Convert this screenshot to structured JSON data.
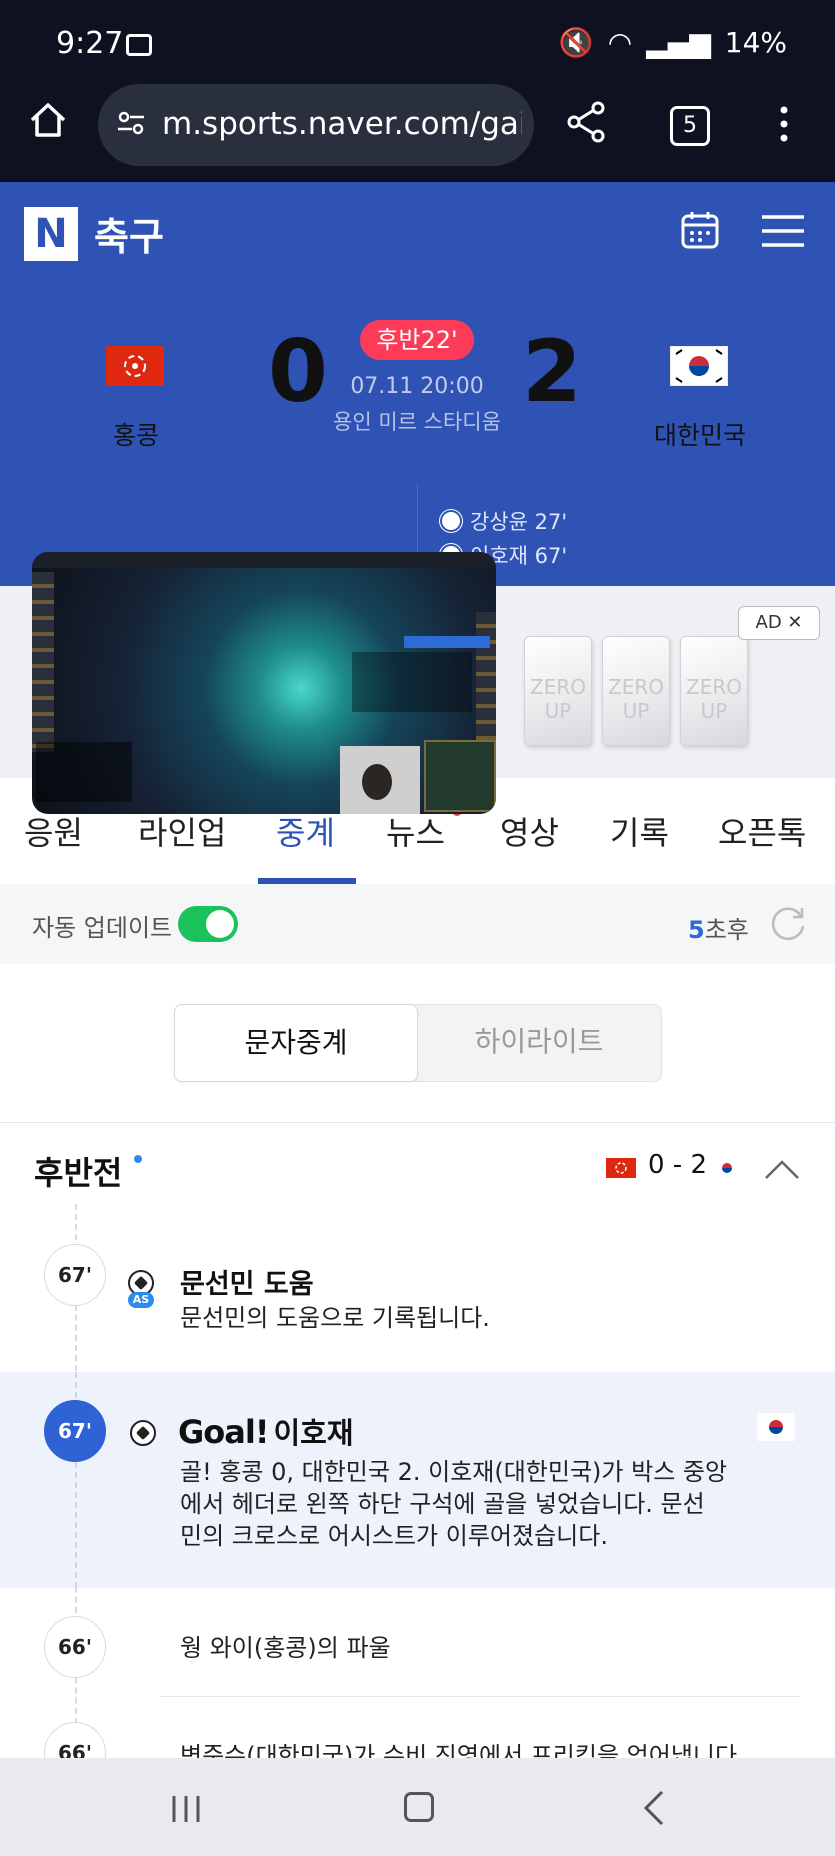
{
  "status_bar": {
    "time": "9:27",
    "battery": "14%"
  },
  "browser": {
    "url": "m.sports.naver.com/gai",
    "tab_count": "5"
  },
  "header": {
    "logo": "N",
    "section": "축구"
  },
  "match": {
    "home_team": "홍콩",
    "away_team": "대한민국",
    "home_score": "0",
    "away_score": "2",
    "period": "후반22'",
    "datetime": "07.11 20:00",
    "stadium": "용인 미르 스타디움",
    "scorers": [
      "강상윤 27'",
      "이호재 67'"
    ]
  },
  "ad": {
    "label": "AD ✕",
    "card_text": "ZERO UP"
  },
  "tabs": [
    "응원",
    "라인업",
    "중계",
    "뉴스",
    "영상",
    "기록",
    "오픈톡"
  ],
  "active_tab": "중계",
  "auto_update": {
    "label": "자동 업데이트",
    "seconds": "5",
    "suffix": "초후",
    "enabled": true
  },
  "segment": {
    "text_relay": "문자중계",
    "highlight": "하이라이트"
  },
  "half": {
    "title": "후반전",
    "score": "0 - 2"
  },
  "events": [
    {
      "minute": "67'",
      "title": "문선민 도움",
      "body": "문선민의 도움으로 기록됩니다.",
      "badge": "AS"
    },
    {
      "minute": "67'",
      "goal_word": "Goal!",
      "title": "이호재",
      "body_lines": [
        "골! 홍콩 0, 대한민국 2. 이호재(대한민국)가 박스 중앙",
        "에서 헤더로 왼쪽 하단 구석에 골을 넣었습니다. 문선",
        "민의 크로스로 어시스트가 이루어졌습니다."
      ]
    },
    {
      "minute": "66'",
      "body": "웡 와이(홍콩)의 파울"
    },
    {
      "minute": "66'",
      "body": "변준수(대한민국)가 수비 진영에서 프리킥을 얻어냅니다."
    }
  ],
  "colors": {
    "naver_blue": "#2f53b5",
    "period_red": "#fb3b58",
    "toggle_green": "#1bc25b"
  }
}
